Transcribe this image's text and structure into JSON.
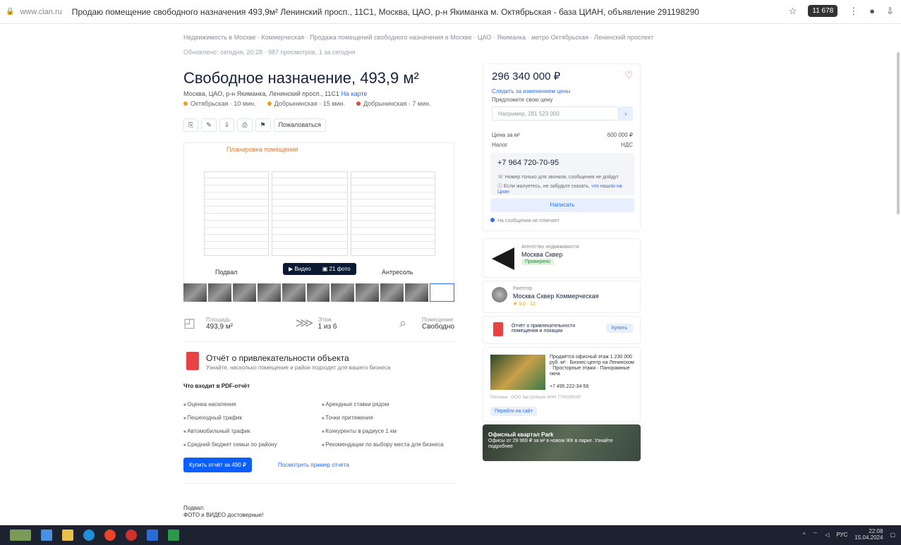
{
  "browser": {
    "url": "www.cian.ru",
    "tab_title": "Продаю помещение свободного назначения 493,9м² Ленинский просп., 11С1, Москва, ЦАО, р-н Якиманка м. Октябрьская - база ЦИАН, объявление 291198290",
    "badge": "11 678"
  },
  "listing": {
    "breadcrumbs": "Недвижимость в Москве · Коммерческая · Продажа помещений свободного назначения в Москве · ЦАО · Якиманка · метро Октябрьская · Ленинский проспект",
    "meta": "Обновлено: сегодня, 20:28 · 987 просмотров, 1 за сегодня",
    "title": "Свободное назначение, 493,9 м²",
    "address": "Москва, ЦАО, р-н Якиманка, Ленинский просп., 11С1",
    "address_link": "На карте",
    "metro": [
      {
        "name": "Октябрьская",
        "time": "10 мин.",
        "color": "#e8a317"
      },
      {
        "name": "Добрынинская",
        "time": "15 мин.",
        "color": "#e8a317"
      },
      {
        "name": "Добрынинская",
        "time": "7 мин.",
        "color": "#e84242"
      }
    ],
    "action_buttons": [
      "⎘",
      "✎",
      "⇩",
      "⎙",
      "⚑",
      "Пожаловаться"
    ],
    "gallery": {
      "caption": "Планировка помещения",
      "label_left": "Подвал",
      "label_right": "Антресоль",
      "btn_video": "▶ Видео",
      "btn_photos": "▣ 21 фото"
    },
    "facts": [
      {
        "icon": "area-icon",
        "glyph": "◰",
        "label": "Площадь",
        "value": "493,9 м²"
      },
      {
        "icon": "floor-icon",
        "glyph": "⋙",
        "label": "Этаж",
        "value": "1 из 6"
      },
      {
        "icon": "search-icon",
        "glyph": "⌕",
        "label": "Помещение",
        "value": "Свободно"
      }
    ],
    "report": {
      "title": "Отчёт о привлекательности объекта",
      "subtitle": "Узнайте, насколько помещение и район подходят для вашего бизнеса",
      "heading": "Что входит в PDF-отчёт",
      "col1": [
        "Оценка населения",
        "Пешеходный трафик",
        "Автомобильный трафик",
        "Средний бюджет семьи по району"
      ],
      "col2": [
        "Арендные ставки рядом",
        "Точки притяжения",
        "Конкуренты в радиусе 1 км",
        "Рекомендации по выбору места для бизнеса"
      ],
      "buy_button": "Купить отчёт за 490 ₽",
      "sample_link": "Посмотреть пример отчёта"
    },
    "description": [
      "Подвал:",
      "ФОТО и ВИДЕО достоверные!"
    ]
  },
  "sidebar": {
    "price": "296 340 000 ₽",
    "price_link": "Следить за изменением цены",
    "offer_label": "Предложите свою цену",
    "offer_placeholder": "Например, 281 523 000",
    "offer_go": "›",
    "rows": [
      {
        "k": "Цена за м²",
        "v": "600 000 ₽"
      },
      {
        "k": "Налог",
        "v": "НДС"
      }
    ],
    "phone": "+7 964 720-70-95",
    "phone_note": "Номер только для звонков, сообщения не дойдут",
    "phone_note2": "Если жалуетесь, не забудьте сказать,",
    "phone_note2_link": "что нашли на Циан",
    "message_button": "Написать",
    "checkbox_text": "На сообщения не отвечает"
  },
  "agency": {
    "label": "Агентство недвижимости",
    "name": "Москва Сквер",
    "verified": "Проверено"
  },
  "agent": {
    "label": "Риелтор",
    "name": "Москва Сквер Коммерческая",
    "rating": "★ 5.0 · 12"
  },
  "report2": {
    "title": "Отчёт о привлекательности помещения и локации",
    "button": "Купить"
  },
  "ad": {
    "text": "Продаётся офисный этаж 1 230 000 руб. м² · Бизнес-центр на Ленинском · Просторные этажи · Панорамные окна",
    "phone": "+7 495 222-34-56",
    "note": "Реклама · ООО Застройщик ИНН 7700000000",
    "button": "Перейти на сайт"
  },
  "banner": {
    "title": "Офисный квартал Park",
    "subtitle": "Офисы от 29 969 ₽ за м² в новом ЖК в парке. Узнайте подробнее"
  },
  "taskbar": {
    "lang": "РУС",
    "time": "22:08",
    "date": "15.04.2024"
  }
}
